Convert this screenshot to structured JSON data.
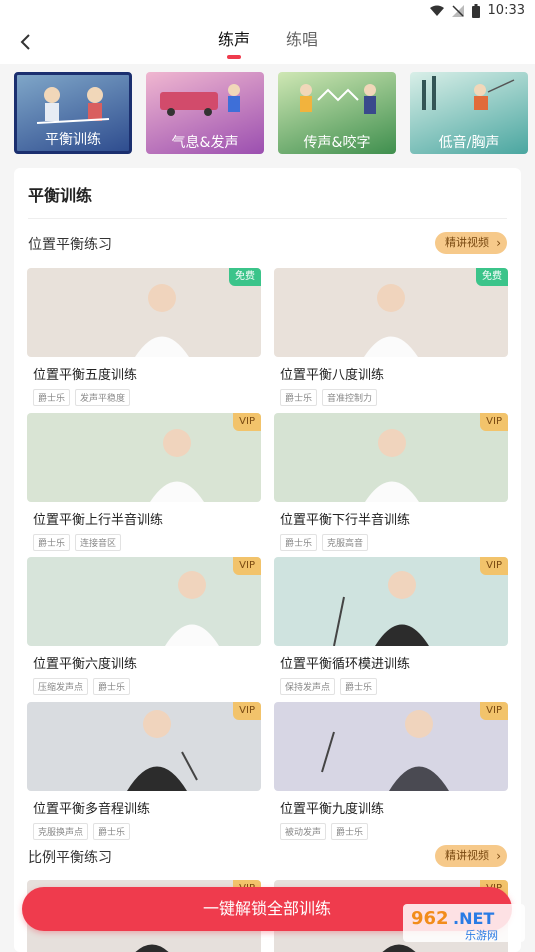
{
  "status": {
    "time": "10:33"
  },
  "header": {
    "tabs": [
      {
        "label": "练声",
        "active": true
      },
      {
        "label": "练唱",
        "active": false
      }
    ]
  },
  "categories": [
    {
      "label": "平衡训练",
      "active": true,
      "color": "#2f4d8f"
    },
    {
      "label": "气息&发声",
      "active": false,
      "color": "#9b4fb0"
    },
    {
      "label": "传声&咬字",
      "active": false,
      "color": "#3f8f4e"
    },
    {
      "label": "低音/胸声",
      "active": false,
      "color": "#4aa6a0"
    }
  ],
  "panel": {
    "title": "平衡训练",
    "sections": [
      {
        "title": "位置平衡练习",
        "detail_label": "精讲视频",
        "cards": [
          {
            "title": "位置平衡五度训练",
            "badge": "免费",
            "tags": [
              "爵士乐",
              "发声平稳度"
            ],
            "bg": "#e8e1da"
          },
          {
            "title": "位置平衡八度训练",
            "badge": "免费",
            "tags": [
              "爵士乐",
              "音准控制力"
            ],
            "bg": "#e9e1da"
          },
          {
            "title": "位置平衡上行半音训练",
            "badge": "VIP",
            "tags": [
              "爵士乐",
              "连接音区"
            ],
            "bg": "#d9e4d4"
          },
          {
            "title": "位置平衡下行半音训练",
            "badge": "VIP",
            "tags": [
              "爵士乐",
              "克服高音"
            ],
            "bg": "#d6e3d3"
          },
          {
            "title": "位置平衡六度训练",
            "badge": "VIP",
            "tags": [
              "压缩发声点",
              "爵士乐"
            ],
            "bg": "#d7e4da"
          },
          {
            "title": "位置平衡循环模进训练",
            "badge": "VIP",
            "tags": [
              "保持发声点",
              "爵士乐"
            ],
            "bg": "#cfe3df"
          },
          {
            "title": "位置平衡多音程训练",
            "badge": "VIP",
            "tags": [
              "克服换声点",
              "爵士乐"
            ],
            "bg": "#d9dce0"
          },
          {
            "title": "位置平衡九度训练",
            "badge": "VIP",
            "tags": [
              "被动发声",
              "爵士乐"
            ],
            "bg": "#d7d6e4"
          }
        ]
      },
      {
        "title": "比例平衡练习",
        "detail_label": "精讲视频",
        "cards": [
          {
            "title": "",
            "badge": "VIP",
            "tags": [],
            "bg": "#e6e0dc"
          },
          {
            "title": "",
            "badge": "VIP",
            "tags": [],
            "bg": "#e6e0dc"
          }
        ]
      }
    ]
  },
  "cta": {
    "label": "一键解锁全部训练"
  },
  "watermark": {
    "line1": "962.NET",
    "line2": "乐游网"
  },
  "colors": {
    "accent": "#ef3b4d",
    "badge_free": "#3bc48a",
    "badge_vip": "#f2c36b"
  },
  "icons": [
    "back-icon",
    "wifi-icon",
    "signal-icon",
    "battery-icon",
    "chevron-right-icon"
  ]
}
